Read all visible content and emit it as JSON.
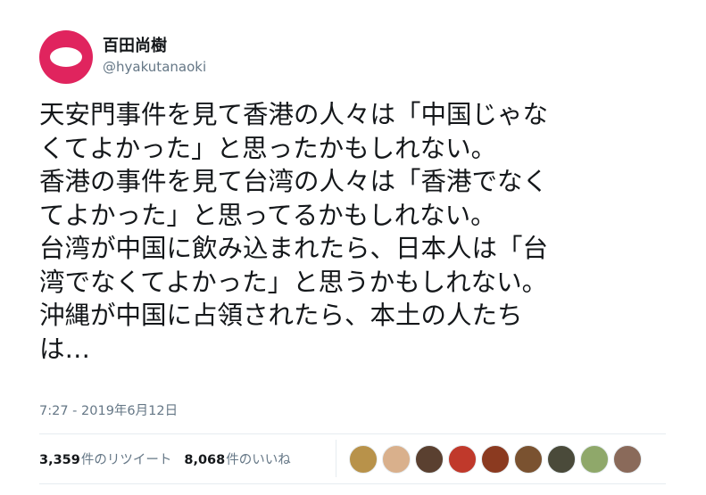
{
  "author": {
    "display_name": "百田尚樹",
    "handle": "@hyakutanaoki",
    "avatar_color": "#e0245e"
  },
  "tweet": {
    "text": "天安門事件を見て香港の人々は「中国じゃな\nくてよかった」と思ったかもしれない。\n香港の事件を見て台湾の人々は「香港でなく\nてよかった」と思ってるかもしれない。\n台湾が中国に飲み込まれたら、日本人は「台\n湾でなくてよかった」と思うかもしれない。\n沖縄が中国に占領されたら、本土の人たち\nは…",
    "timestamp": "7:27 - 2019年6月12日"
  },
  "stats": {
    "retweets_count": "3,359",
    "retweets_label": "件のリツイート",
    "likes_count": "8,068",
    "likes_label": "件のいいね"
  },
  "liker_avatars": [
    {
      "color": "#b8924a"
    },
    {
      "color": "#d9b08c"
    },
    {
      "color": "#5a4030"
    },
    {
      "color": "#c0392b"
    },
    {
      "color": "#8b3a20"
    },
    {
      "color": "#7a5230"
    },
    {
      "color": "#4a4a3a"
    },
    {
      "color": "#8fa86a"
    },
    {
      "color": "#8a6a5a"
    }
  ]
}
